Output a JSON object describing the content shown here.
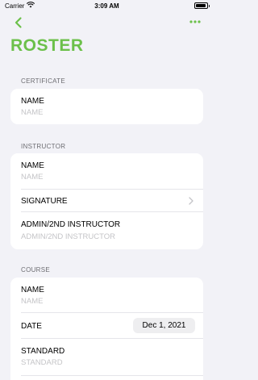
{
  "status_bar": {
    "carrier": "Carrier",
    "time": "3:09 AM"
  },
  "nav": {
    "back_icon": "chevron-left-icon",
    "more_icon": "ellipsis-icon",
    "accent": "#6cc04a"
  },
  "title": "ROSTER",
  "sections": {
    "certificate": {
      "header": "CERTIFICATE",
      "name": {
        "label": "NAME",
        "placeholder": "NAME"
      }
    },
    "instructor": {
      "header": "INSTRUCTOR",
      "name": {
        "label": "NAME",
        "placeholder": "NAME"
      },
      "signature": {
        "label": "SIGNATURE"
      },
      "admin": {
        "label": "ADMIN/2ND INSTRUCTOR",
        "placeholder": "ADMIN/2ND INSTRUCTOR"
      }
    },
    "course": {
      "header": "COURSE",
      "name": {
        "label": "NAME",
        "placeholder": "NAME"
      },
      "date": {
        "label": "DATE",
        "value": "Dec 1, 2021"
      },
      "standard": {
        "label": "STANDARD",
        "placeholder": "STANDARD"
      }
    }
  }
}
